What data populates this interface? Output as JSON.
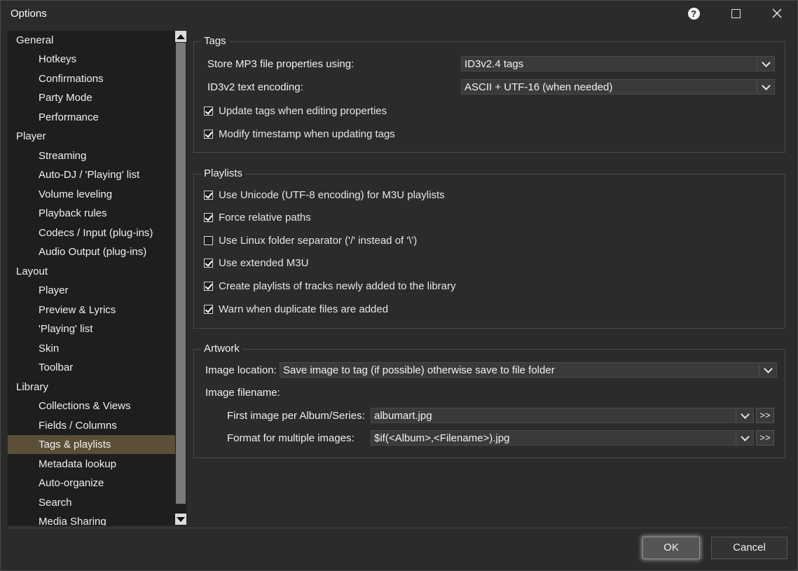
{
  "window": {
    "title": "Options"
  },
  "nav": {
    "items": [
      {
        "label": "General",
        "level": 1
      },
      {
        "label": "Hotkeys",
        "level": 2
      },
      {
        "label": "Confirmations",
        "level": 2
      },
      {
        "label": "Party Mode",
        "level": 2
      },
      {
        "label": "Performance",
        "level": 2
      },
      {
        "label": "Player",
        "level": 1
      },
      {
        "label": "Streaming",
        "level": 2
      },
      {
        "label": "Auto-DJ / 'Playing' list",
        "level": 2
      },
      {
        "label": "Volume leveling",
        "level": 2
      },
      {
        "label": "Playback rules",
        "level": 2
      },
      {
        "label": "Codecs / Input (plug-ins)",
        "level": 2
      },
      {
        "label": "Audio Output (plug-ins)",
        "level": 2
      },
      {
        "label": "Layout",
        "level": 1
      },
      {
        "label": "Player",
        "level": 2
      },
      {
        "label": "Preview & Lyrics",
        "level": 2
      },
      {
        "label": "'Playing' list",
        "level": 2
      },
      {
        "label": "Skin",
        "level": 2
      },
      {
        "label": "Toolbar",
        "level": 2
      },
      {
        "label": "Library",
        "level": 1
      },
      {
        "label": "Collections & Views",
        "level": 2
      },
      {
        "label": "Fields / Columns",
        "level": 2
      },
      {
        "label": "Tags & playlists",
        "level": 2,
        "selected": true
      },
      {
        "label": "Metadata lookup",
        "level": 2
      },
      {
        "label": "Auto-organize",
        "level": 2
      },
      {
        "label": "Search",
        "level": 2
      },
      {
        "label": "Media Sharing",
        "level": 2
      }
    ]
  },
  "tags": {
    "title": "Tags",
    "store_label": "Store MP3 file properties using:",
    "store_value": "ID3v2.4 tags",
    "encoding_label": "ID3v2 text encoding:",
    "encoding_value": "ASCII + UTF-16 (when needed)",
    "checkboxes": [
      {
        "label": "Update tags when editing properties",
        "checked": true
      },
      {
        "label": "Modify timestamp when updating tags",
        "checked": true
      }
    ]
  },
  "playlists": {
    "title": "Playlists",
    "checkboxes": [
      {
        "label": "Use Unicode (UTF-8 encoding) for M3U playlists",
        "checked": true
      },
      {
        "label": "Force relative paths",
        "checked": true
      },
      {
        "label": "Use Linux folder separator ('/' instead of '\\')",
        "checked": false
      },
      {
        "label": "Use extended M3U",
        "checked": true
      },
      {
        "label": "Create playlists of tracks newly added to the library",
        "checked": true
      },
      {
        "label": "Warn when duplicate files are added",
        "checked": true
      }
    ]
  },
  "artwork": {
    "title": "Artwork",
    "location_label": "Image location:",
    "location_value": "Save image to tag (if possible) otherwise save to file folder",
    "filename_label": "Image filename:",
    "first_label": "First image per Album/Series:",
    "first_value": "albumart.jpg",
    "multi_label": "Format for multiple images:",
    "multi_value": "$if(<Album>,<Filename>).jpg",
    "more_label": ">>"
  },
  "footer": {
    "ok_label": "OK",
    "cancel_label": "Cancel"
  }
}
